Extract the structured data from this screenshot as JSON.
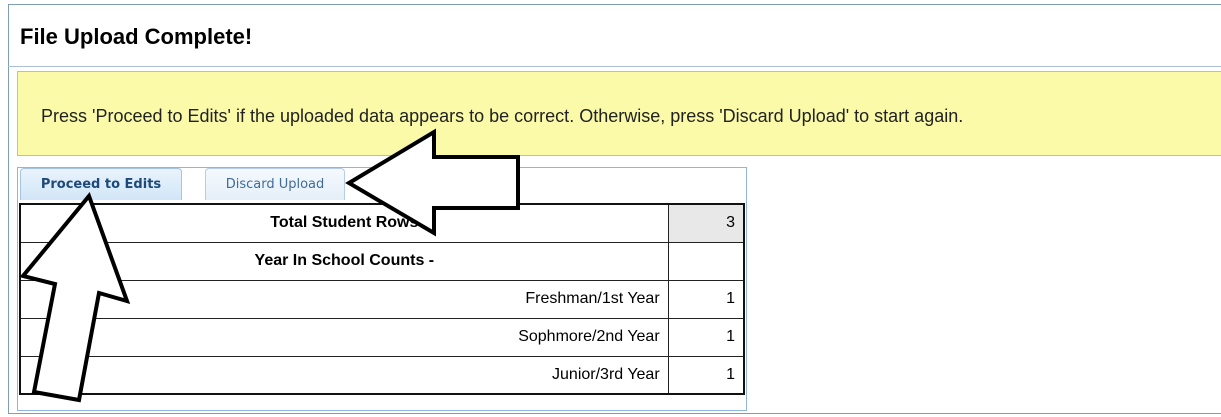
{
  "header": {
    "title": "File Upload Complete!"
  },
  "notice": {
    "message": "Press 'Proceed to Edits' if the uploaded data appears to be correct. Otherwise, press 'Discard Upload' to start again."
  },
  "actions": {
    "proceed_label": "Proceed to Edits",
    "discard_label": "Discard Upload"
  },
  "summary_table": {
    "rows": [
      {
        "label": "Total Student Rows",
        "value": "3"
      },
      {
        "label": "Year In School Counts -",
        "value": ""
      },
      {
        "label": "Freshman/1st Year",
        "value": "1"
      },
      {
        "label": "Sophmore/2nd Year",
        "value": "1"
      },
      {
        "label": "Junior/3rd Year",
        "value": "1"
      }
    ]
  },
  "colors": {
    "notice_background": "#fafaa8",
    "tab_text": "#1d4a7a",
    "border_blue": "#8fb6e0"
  },
  "annotations": {
    "arrow_icons": [
      "arrow-pointing-proceed-icon",
      "arrow-pointing-discard-icon"
    ]
  }
}
